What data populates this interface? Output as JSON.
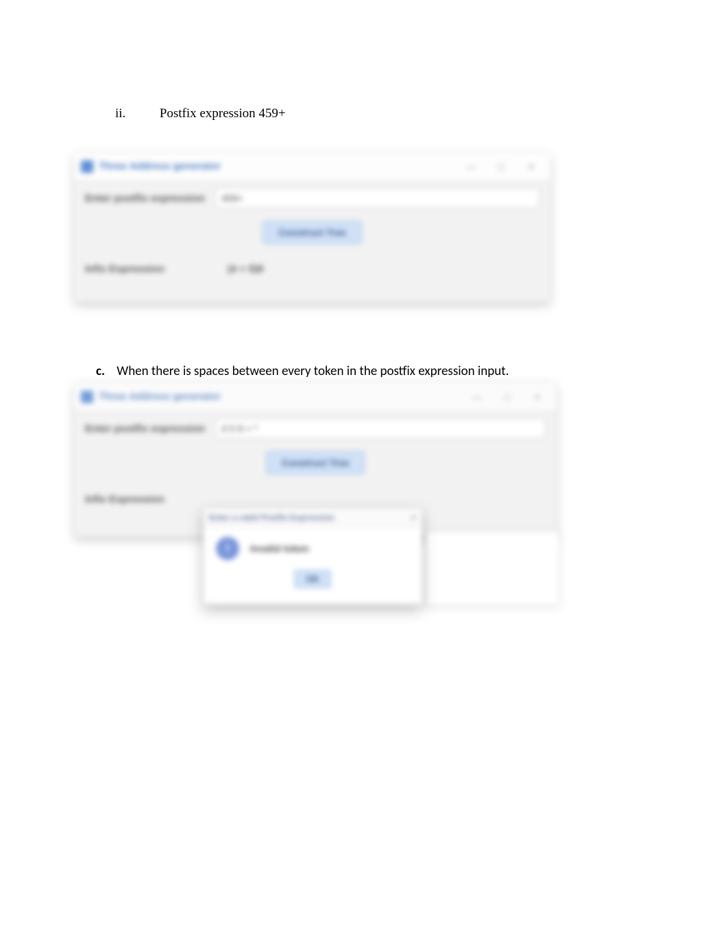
{
  "headings": {
    "ii_num": "ii.",
    "ii_text": "Postfix expression 459+",
    "c_letter": "c.",
    "c_text": "When there is spaces between every token in the postfix expression input."
  },
  "window1": {
    "title": "Three Address generator",
    "input_label": "Enter postfix expression",
    "input_value": "459+",
    "button_label": "Construct Tree",
    "result_label": "Infix Expression",
    "result_value": "(4 + 5)9"
  },
  "window2": {
    "title": "Three Address generator",
    "input_label": "Enter postfix expression",
    "input_value": "4 5 9 + *",
    "button_label": "Construct Tree",
    "result_label": "Infix Expression"
  },
  "dialog": {
    "title": "Enter a valid Postfix Expression",
    "message": "Invalid token",
    "ok_label": "OK"
  },
  "window_controls": {
    "minimize": "—",
    "maximize": "□",
    "close": "×"
  }
}
